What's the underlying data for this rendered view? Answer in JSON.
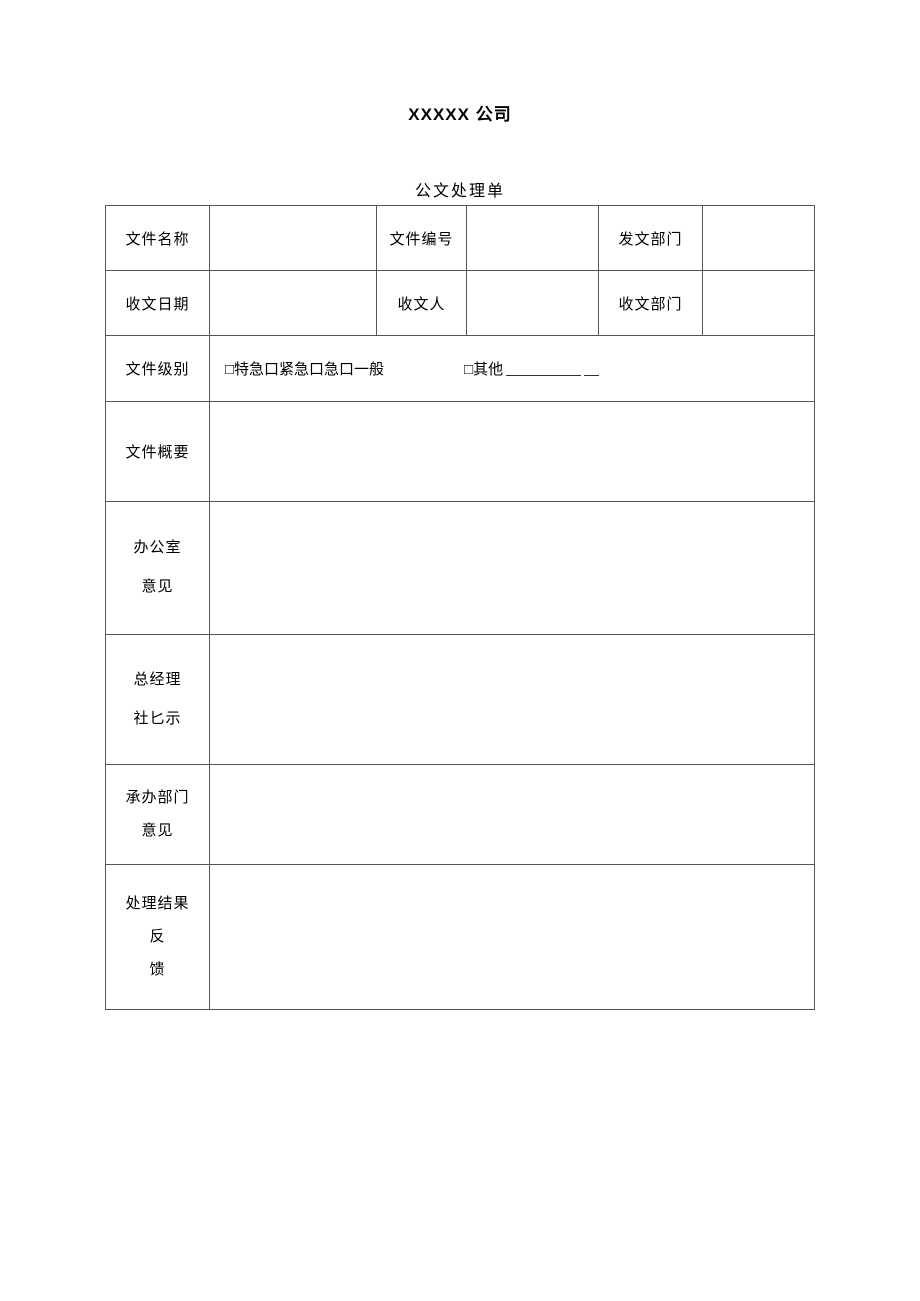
{
  "company_title": "XXXXX 公司",
  "form_title": "公文处理单",
  "labels": {
    "file_name": "文件名称",
    "file_number": "文件编号",
    "issuing_dept": "发文部门",
    "receive_date": "收文日期",
    "receiver": "收文人",
    "receiving_dept": "收文部门",
    "file_level": "文件级别",
    "file_summary": "文件概要",
    "office_line1": "办公室",
    "office_line2": "意见",
    "manager_line1": "总经理",
    "manager_line2": "社匕示",
    "undertake_line1": "承办部门",
    "undertake_line2": "意见",
    "result_line1": "处理结果",
    "result_line2": "反",
    "result_line3": "馈"
  },
  "level_options": {
    "combined": "□特急口紧急口急口一般",
    "other": "□其他"
  },
  "values": {
    "file_name": "",
    "file_number": "",
    "issuing_dept": "",
    "receive_date": "",
    "receiver": "",
    "receiving_dept": "",
    "file_summary": "",
    "office_opinion": "",
    "manager_instruction": "",
    "undertake_opinion": "",
    "result_feedback": "",
    "level_other_text": ""
  }
}
